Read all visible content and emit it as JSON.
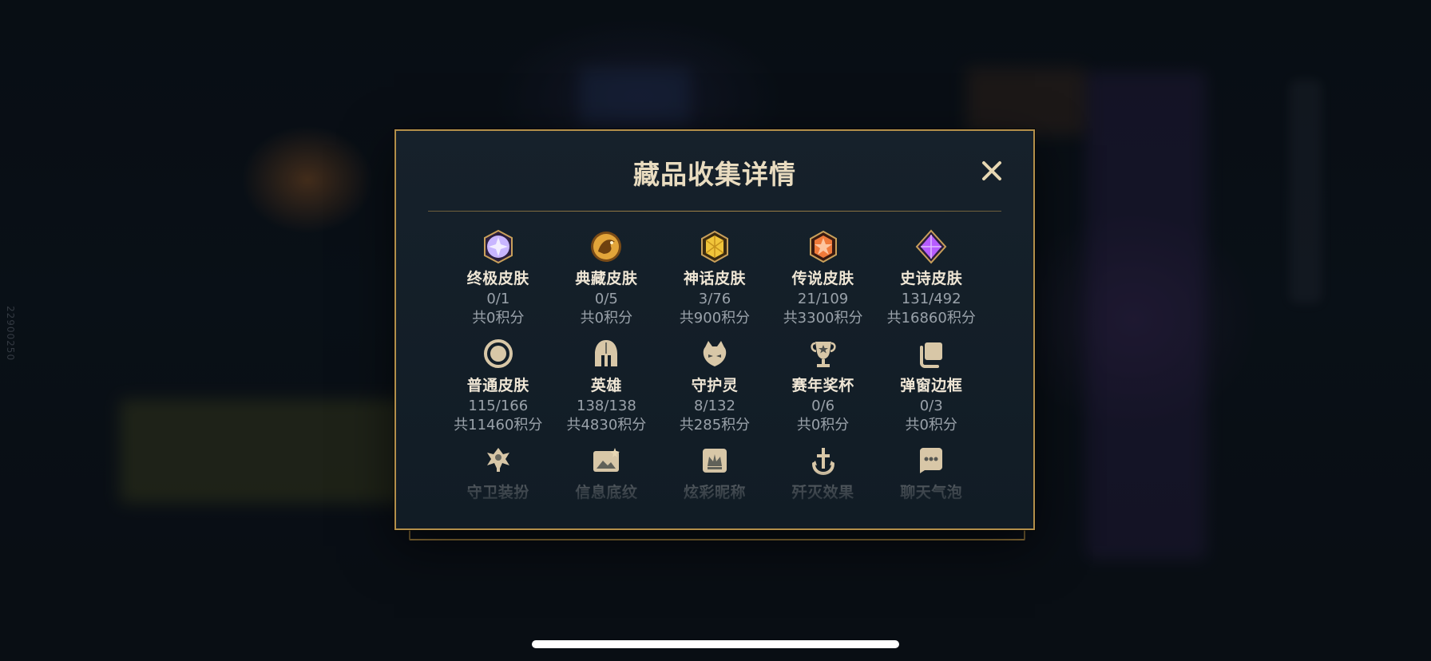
{
  "side_id": "22900250",
  "modal": {
    "title": "藏品收集详情",
    "close_icon": "close-icon",
    "items": [
      {
        "icon": "ultimate-skin-icon",
        "name": "终极皮肤",
        "count": "0/1",
        "points": "共0积分",
        "color": "#c8b5ff"
      },
      {
        "icon": "prestige-skin-icon",
        "name": "典藏皮肤",
        "count": "0/5",
        "points": "共0积分",
        "color": "#e2a53a"
      },
      {
        "icon": "mythic-skin-icon",
        "name": "神话皮肤",
        "count": "3/76",
        "points": "共900积分",
        "color": "#f1c53a"
      },
      {
        "icon": "legendary-skin-icon",
        "name": "传说皮肤",
        "count": "21/109",
        "points": "共3300积分",
        "color": "#f07a3a"
      },
      {
        "icon": "epic-skin-icon",
        "name": "史诗皮肤",
        "count": "131/492",
        "points": "共16860积分",
        "color": "#b65cff"
      },
      {
        "icon": "standard-skin-icon",
        "name": "普通皮肤",
        "count": "115/166",
        "points": "共11460积分",
        "color": "#d8c7a7"
      },
      {
        "icon": "champion-helmet-icon",
        "name": "英雄",
        "count": "138/138",
        "points": "共4830积分",
        "color": "#d8c7a7"
      },
      {
        "icon": "guardian-pet-icon",
        "name": "守护灵",
        "count": "8/132",
        "points": "共285积分",
        "color": "#d8c7a7"
      },
      {
        "icon": "season-trophy-icon",
        "name": "赛年奖杯",
        "count": "0/6",
        "points": "共0积分",
        "color": "#d8c7a7"
      },
      {
        "icon": "popup-frame-icon",
        "name": "弹窗边框",
        "count": "0/3",
        "points": "共0积分",
        "color": "#d8c7a7"
      },
      {
        "icon": "ward-skin-icon",
        "name": "守卫装扮",
        "count": "",
        "points": "",
        "color": "#d8c7a7"
      },
      {
        "icon": "info-banner-icon",
        "name": "信息底纹",
        "count": "",
        "points": "",
        "color": "#d8c7a7"
      },
      {
        "icon": "colorful-name-icon",
        "name": "炫彩昵称",
        "count": "",
        "points": "",
        "color": "#d8c7a7"
      },
      {
        "icon": "ace-effect-icon",
        "name": "歼灭效果",
        "count": "",
        "points": "",
        "color": "#d8c7a7"
      },
      {
        "icon": "chat-bubble-icon",
        "name": "聊天气泡",
        "count": "",
        "points": "",
        "color": "#d8c7a7"
      }
    ]
  }
}
